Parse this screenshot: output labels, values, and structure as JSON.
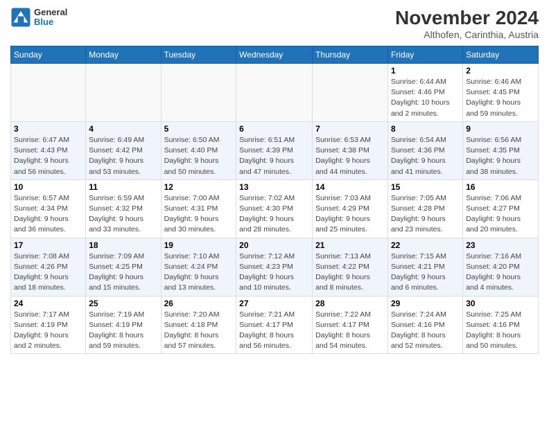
{
  "logo": {
    "line1": "General",
    "line2": "Blue"
  },
  "title": "November 2024",
  "location": "Althofen, Carinthia, Austria",
  "weekdays": [
    "Sunday",
    "Monday",
    "Tuesday",
    "Wednesday",
    "Thursday",
    "Friday",
    "Saturday"
  ],
  "weeks": [
    [
      {
        "day": "",
        "info": ""
      },
      {
        "day": "",
        "info": ""
      },
      {
        "day": "",
        "info": ""
      },
      {
        "day": "",
        "info": ""
      },
      {
        "day": "",
        "info": ""
      },
      {
        "day": "1",
        "info": "Sunrise: 6:44 AM\nSunset: 4:46 PM\nDaylight: 10 hours\nand 2 minutes."
      },
      {
        "day": "2",
        "info": "Sunrise: 6:46 AM\nSunset: 4:45 PM\nDaylight: 9 hours\nand 59 minutes."
      }
    ],
    [
      {
        "day": "3",
        "info": "Sunrise: 6:47 AM\nSunset: 4:43 PM\nDaylight: 9 hours\nand 56 minutes."
      },
      {
        "day": "4",
        "info": "Sunrise: 6:49 AM\nSunset: 4:42 PM\nDaylight: 9 hours\nand 53 minutes."
      },
      {
        "day": "5",
        "info": "Sunrise: 6:50 AM\nSunset: 4:40 PM\nDaylight: 9 hours\nand 50 minutes."
      },
      {
        "day": "6",
        "info": "Sunrise: 6:51 AM\nSunset: 4:39 PM\nDaylight: 9 hours\nand 47 minutes."
      },
      {
        "day": "7",
        "info": "Sunrise: 6:53 AM\nSunset: 4:38 PM\nDaylight: 9 hours\nand 44 minutes."
      },
      {
        "day": "8",
        "info": "Sunrise: 6:54 AM\nSunset: 4:36 PM\nDaylight: 9 hours\nand 41 minutes."
      },
      {
        "day": "9",
        "info": "Sunrise: 6:56 AM\nSunset: 4:35 PM\nDaylight: 9 hours\nand 38 minutes."
      }
    ],
    [
      {
        "day": "10",
        "info": "Sunrise: 6:57 AM\nSunset: 4:34 PM\nDaylight: 9 hours\nand 36 minutes."
      },
      {
        "day": "11",
        "info": "Sunrise: 6:59 AM\nSunset: 4:32 PM\nDaylight: 9 hours\nand 33 minutes."
      },
      {
        "day": "12",
        "info": "Sunrise: 7:00 AM\nSunset: 4:31 PM\nDaylight: 9 hours\nand 30 minutes."
      },
      {
        "day": "13",
        "info": "Sunrise: 7:02 AM\nSunset: 4:30 PM\nDaylight: 9 hours\nand 28 minutes."
      },
      {
        "day": "14",
        "info": "Sunrise: 7:03 AM\nSunset: 4:29 PM\nDaylight: 9 hours\nand 25 minutes."
      },
      {
        "day": "15",
        "info": "Sunrise: 7:05 AM\nSunset: 4:28 PM\nDaylight: 9 hours\nand 23 minutes."
      },
      {
        "day": "16",
        "info": "Sunrise: 7:06 AM\nSunset: 4:27 PM\nDaylight: 9 hours\nand 20 minutes."
      }
    ],
    [
      {
        "day": "17",
        "info": "Sunrise: 7:08 AM\nSunset: 4:26 PM\nDaylight: 9 hours\nand 18 minutes."
      },
      {
        "day": "18",
        "info": "Sunrise: 7:09 AM\nSunset: 4:25 PM\nDaylight: 9 hours\nand 15 minutes."
      },
      {
        "day": "19",
        "info": "Sunrise: 7:10 AM\nSunset: 4:24 PM\nDaylight: 9 hours\nand 13 minutes."
      },
      {
        "day": "20",
        "info": "Sunrise: 7:12 AM\nSunset: 4:23 PM\nDaylight: 9 hours\nand 10 minutes."
      },
      {
        "day": "21",
        "info": "Sunrise: 7:13 AM\nSunset: 4:22 PM\nDaylight: 9 hours\nand 8 minutes."
      },
      {
        "day": "22",
        "info": "Sunrise: 7:15 AM\nSunset: 4:21 PM\nDaylight: 9 hours\nand 6 minutes."
      },
      {
        "day": "23",
        "info": "Sunrise: 7:16 AM\nSunset: 4:20 PM\nDaylight: 9 hours\nand 4 minutes."
      }
    ],
    [
      {
        "day": "24",
        "info": "Sunrise: 7:17 AM\nSunset: 4:19 PM\nDaylight: 9 hours\nand 2 minutes."
      },
      {
        "day": "25",
        "info": "Sunrise: 7:19 AM\nSunset: 4:19 PM\nDaylight: 8 hours\nand 59 minutes."
      },
      {
        "day": "26",
        "info": "Sunrise: 7:20 AM\nSunset: 4:18 PM\nDaylight: 8 hours\nand 57 minutes."
      },
      {
        "day": "27",
        "info": "Sunrise: 7:21 AM\nSunset: 4:17 PM\nDaylight: 8 hours\nand 56 minutes."
      },
      {
        "day": "28",
        "info": "Sunrise: 7:22 AM\nSunset: 4:17 PM\nDaylight: 8 hours\nand 54 minutes."
      },
      {
        "day": "29",
        "info": "Sunrise: 7:24 AM\nSunset: 4:16 PM\nDaylight: 8 hours\nand 52 minutes."
      },
      {
        "day": "30",
        "info": "Sunrise: 7:25 AM\nSunset: 4:16 PM\nDaylight: 8 hours\nand 50 minutes."
      }
    ]
  ]
}
